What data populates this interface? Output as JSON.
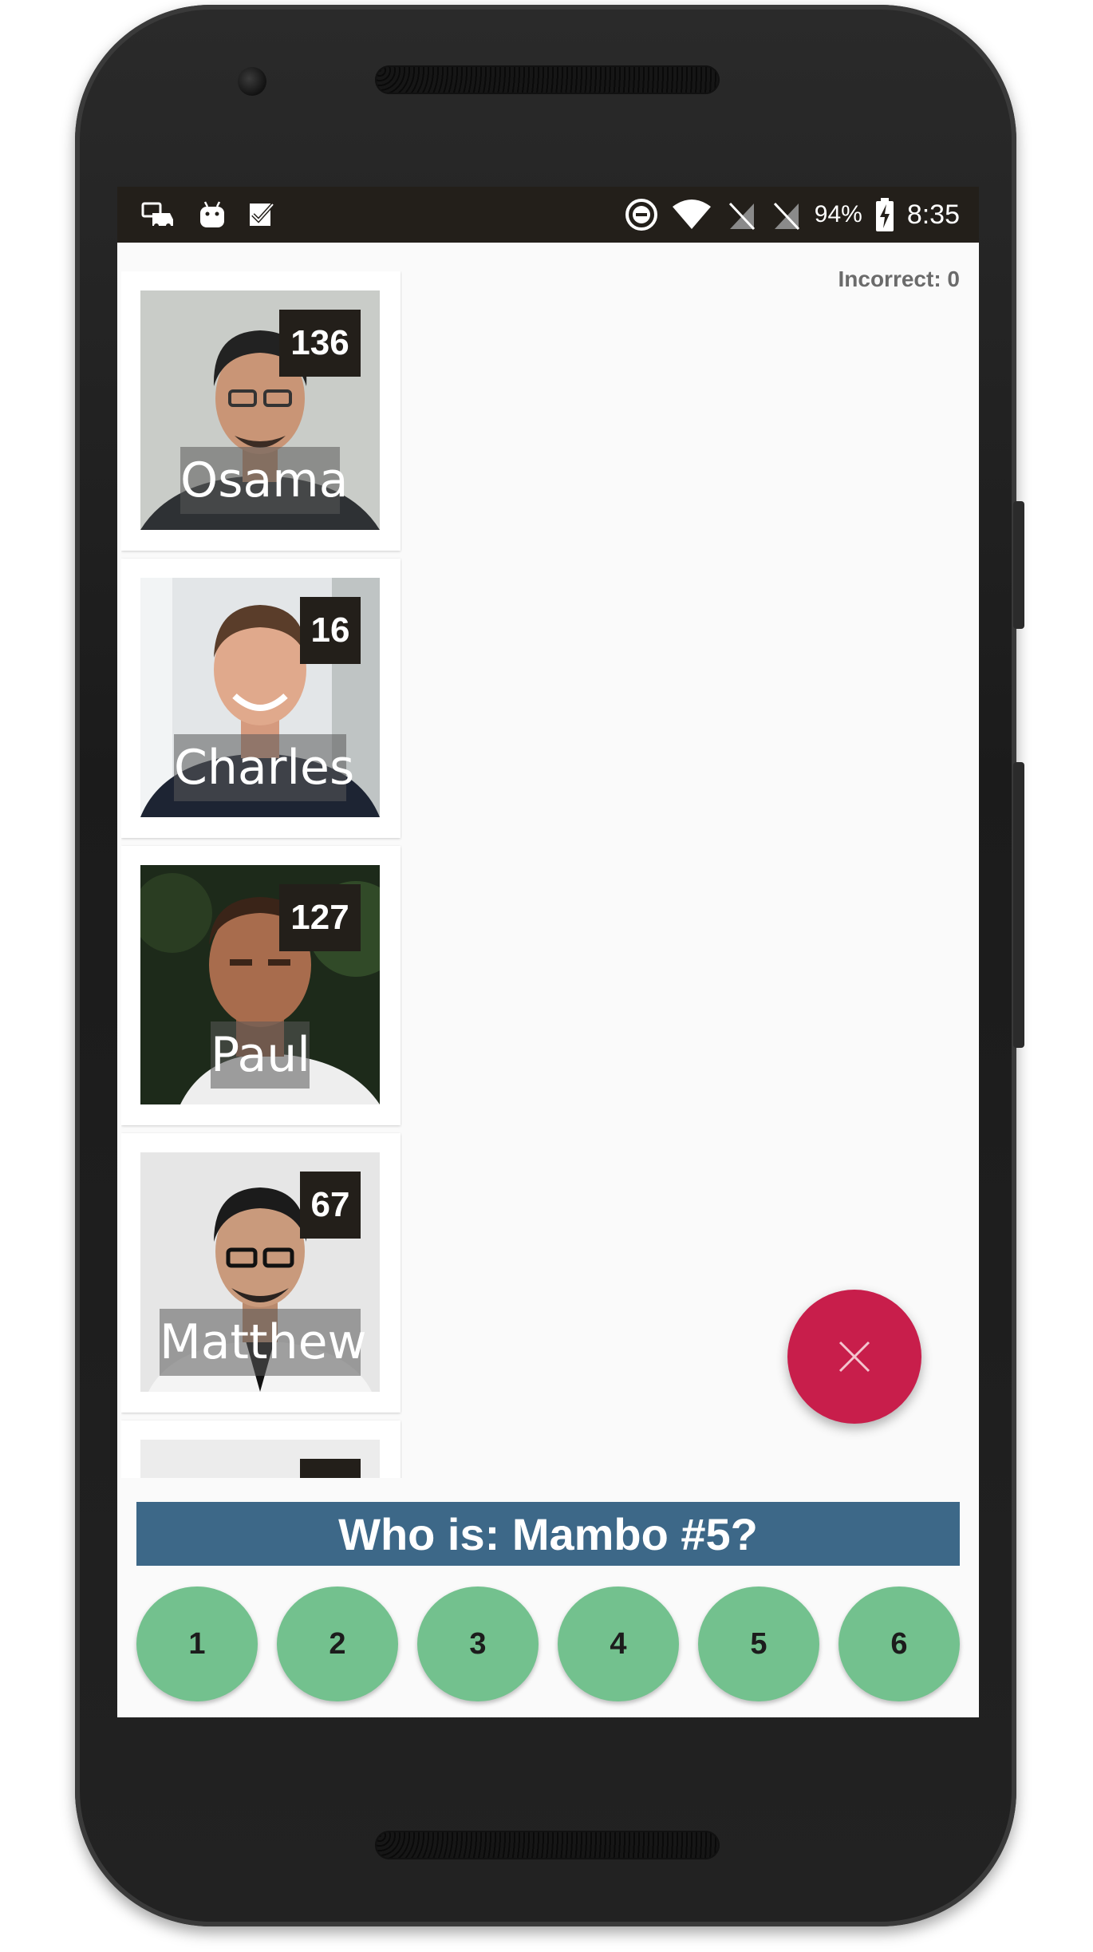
{
  "status_bar": {
    "battery": "94%",
    "time": "8:35"
  },
  "score": {
    "incorrect_label": "Incorrect: 0"
  },
  "cards": [
    {
      "name": "Osama",
      "number": "136"
    },
    {
      "name": "Charles",
      "number": "16"
    },
    {
      "name": "Paul",
      "number": "127"
    },
    {
      "name": "Matthew",
      "number": "67"
    }
  ],
  "question": {
    "text": "Who is: Mambo #5?"
  },
  "answers": [
    "1",
    "2",
    "3",
    "4",
    "5",
    "6"
  ],
  "icons": {
    "status_left": [
      "car-notification-icon",
      "android-notification-icon",
      "task-check-icon"
    ],
    "status_right": [
      "do-not-disturb-icon",
      "wifi-icon",
      "no-sim-icon",
      "no-sim-icon-2",
      "battery-charging-icon"
    ],
    "fab": "close-icon"
  },
  "colors": {
    "status_bar": "#231f1a",
    "question_bar": "#3d6888",
    "answer_button": "#73c18e",
    "fab": "#c81e4b",
    "number_badge": "#231f1a"
  }
}
